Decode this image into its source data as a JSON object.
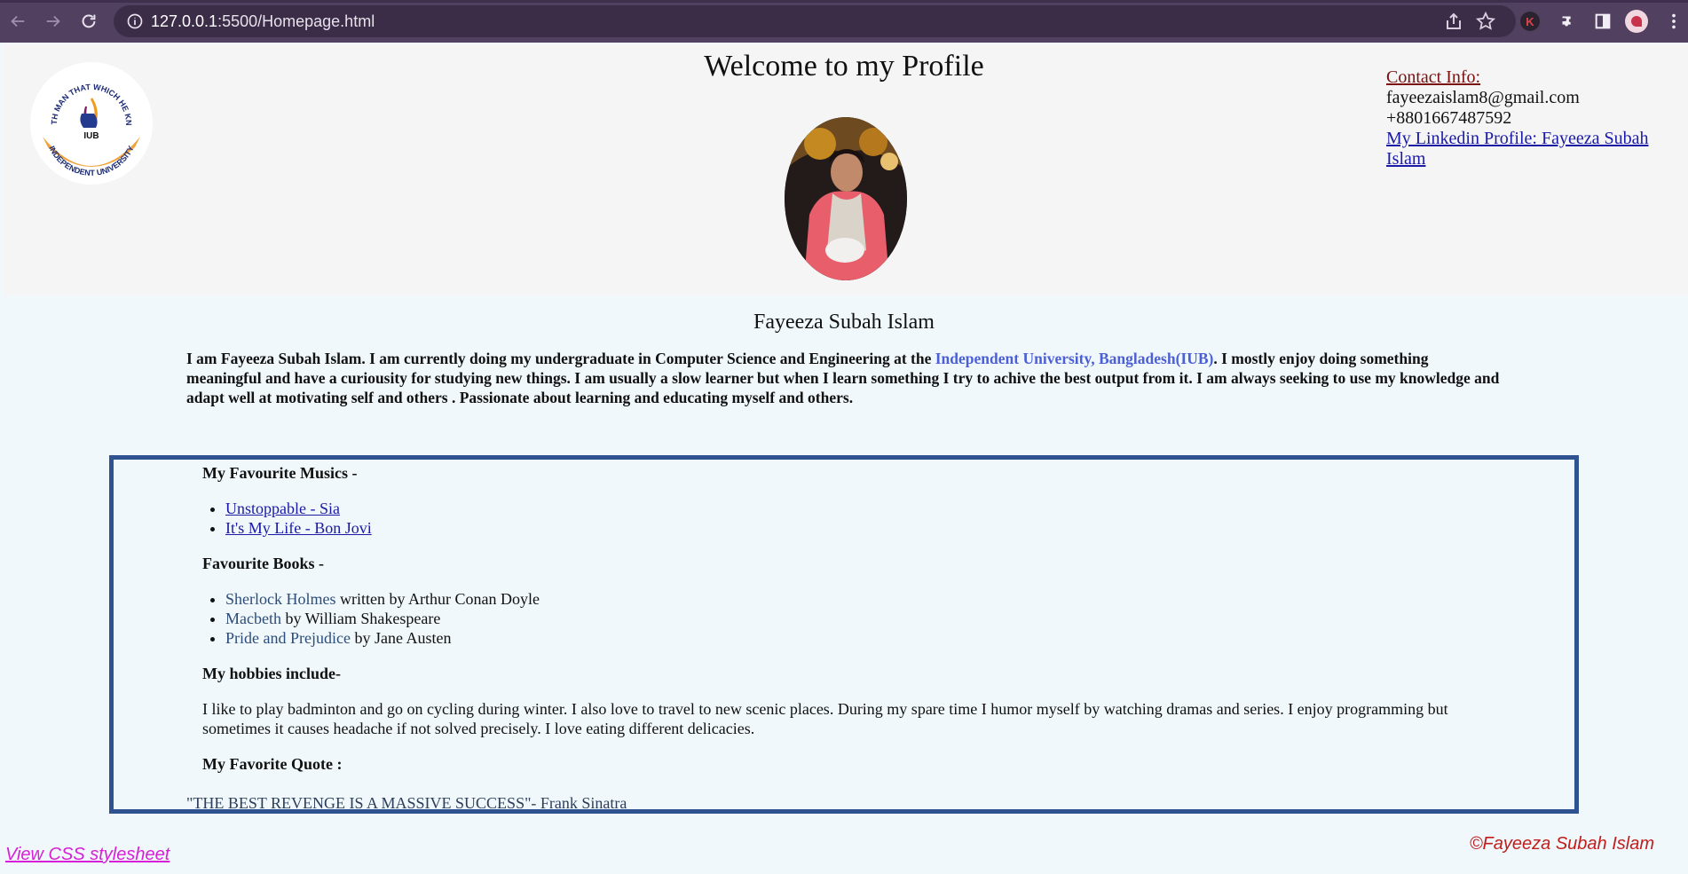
{
  "browser": {
    "url_host": "127.0.0.1",
    "url_rest": ":5500/Homepage.html",
    "extension_k_label": "K"
  },
  "header": {
    "welcome": "Welcome to my Profile",
    "logo_arc_top": "TEACHETH MAN THAT WHICH HE KNEW NOT",
    "logo_arc_bottom": "INDEPENDENT UNIVERSITY",
    "logo_center": "IUB"
  },
  "contact": {
    "title": "Contact Info:",
    "email": "fayeezaislam8@gmail.com",
    "phone": "+8801667487592",
    "linkedin": "My Linkedin Profile: Fayeeza Subah Islam"
  },
  "profile": {
    "name": "Fayeeza Subah Islam",
    "bio_before": "I am Fayeeza Subah Islam. I am currently doing my undergraduate in Computer Science and Engineering at the ",
    "bio_university": "Independent University, Bangladesh(IUB)",
    "bio_after": ". I mostly enjoy doing something meaningful and have a curiousity for studying new things. I am usually a slow learner but when I learn something I try to achive the best output from it. I am always seeking to use my knowledge and adapt well at motivating self and others . Passionate about learning and educating myself and others."
  },
  "favourites": {
    "music_heading": "My Favourite Musics -",
    "music": [
      "Unstoppable - Sia",
      "It's My Life - Bon Jovi"
    ],
    "books_heading": "Favourite Books -",
    "books": [
      {
        "title": "Sherlock Holmes",
        "by": " written by Arthur Conan Doyle"
      },
      {
        "title": "Macbeth",
        "by": " by William Shakespeare"
      },
      {
        "title": "Pride and Prejudice",
        "by": " by Jane Austen"
      }
    ],
    "hobbies_heading": "My hobbies include-",
    "hobbies_text": "I like to play badminton and go on cycling during winter. I also love to travel to new scenic places. During my spare time I humor myself by watching dramas and series. I enjoy programming but sometimes it causes headache if not solved precisely. I love eating different delicacies.",
    "quote_heading": "My Favorite Quote :",
    "quote": "\"THE BEST REVENGE IS A MASSIVE SUCCESS\"- Frank Sinatra"
  },
  "footer": {
    "copyright": "©Fayeeza Subah Islam",
    "css_link": "View CSS stylesheet"
  }
}
